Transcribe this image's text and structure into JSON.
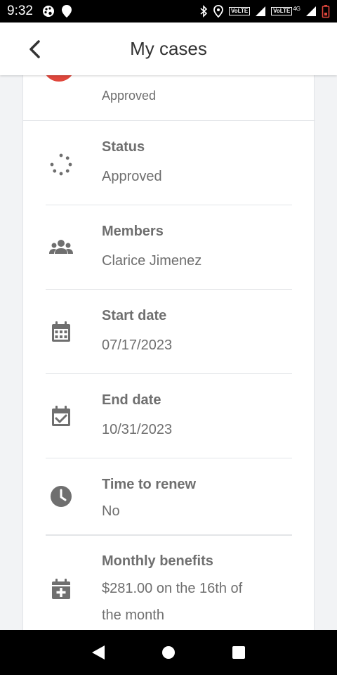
{
  "status_bar": {
    "time": "9:32",
    "volte_1": "VoLTE",
    "volte_2": "VoLTE",
    "network": "4G"
  },
  "app_bar": {
    "title": "My cases"
  },
  "case": {
    "header_status": "Approved",
    "category_icon": "food-utensils-icon",
    "category_color": "#e0473c",
    "accent_color": "#1f6fa8",
    "rows": [
      {
        "label": "Status",
        "value": "Approved",
        "icon": "spinner-dots-icon"
      },
      {
        "label": "Members",
        "value": "Clarice Jimenez",
        "icon": "group-icon"
      },
      {
        "label": "Start date",
        "value": "07/17/2023",
        "icon": "calendar-icon"
      },
      {
        "label": "End date",
        "value": "10/31/2023",
        "icon": "calendar-check-icon"
      },
      {
        "label": "Time to renew",
        "value": "No",
        "icon": "clock-icon"
      },
      {
        "label": "Monthly benefits",
        "value": "$281.00 on the 16th of the month",
        "icon": "calendar-plus-icon"
      }
    ]
  }
}
